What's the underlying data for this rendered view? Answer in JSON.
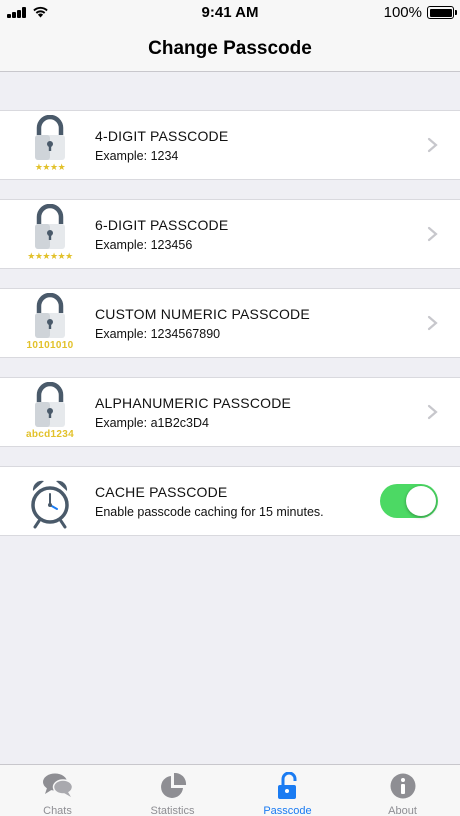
{
  "status_bar": {
    "time": "9:41 AM",
    "battery": "100%"
  },
  "header": {
    "title": "Change Passcode"
  },
  "options": [
    {
      "title": "4-DIGIT PASSCODE",
      "subtitle": "Example: 1234",
      "badge": "★★★★"
    },
    {
      "title": "6-DIGIT PASSCODE",
      "subtitle": "Example: 123456",
      "badge": "★★★★★★"
    },
    {
      "title": "CUSTOM NUMERIC PASSCODE",
      "subtitle": "Example: 1234567890",
      "badge": "10101010"
    },
    {
      "title": "ALPHANUMERIC PASSCODE",
      "subtitle": "Example: a1B2c3D4",
      "badge": "abcd1234"
    }
  ],
  "cache": {
    "title": "CACHE PASSCODE",
    "subtitle": "Enable passcode caching for 15 minutes.",
    "enabled": true
  },
  "tabs": [
    {
      "label": "Chats",
      "icon": "chat-bubbles-icon"
    },
    {
      "label": "Statistics",
      "icon": "pie-chart-icon"
    },
    {
      "label": "Passcode",
      "icon": "unlock-icon",
      "active": true
    },
    {
      "label": "About",
      "icon": "info-icon"
    }
  ],
  "colors": {
    "accent": "#1a7bf2",
    "toggle_on": "#4cd964",
    "badge": "#e2c12a",
    "lock_body": "#dfe3e6",
    "lock_shackle": "#4a5a6a"
  }
}
